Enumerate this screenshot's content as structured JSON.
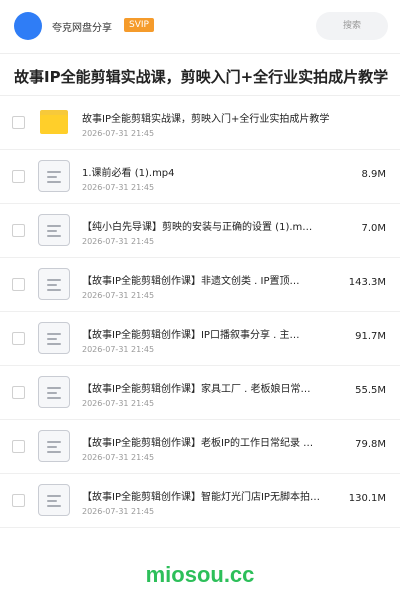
{
  "header": {
    "site_name": "夸克网盘分享",
    "badge": "SVIP",
    "search_label": "搜索"
  },
  "share_title": "故事IP全能剪辑实战课，剪映入门+全行业实拍成片教学",
  "files": [
    {
      "name": "故事IP全能剪辑实战课，剪映入门+全行业实拍成片教学",
      "date": "2026-07-31 21:45",
      "size": "",
      "icon": "folder-icon"
    },
    {
      "name": "1.课前必看 (1).mp4",
      "date": "2026-07-31 21:45",
      "size": "8.9M",
      "icon": "file-icon"
    },
    {
      "name": "【纯小白先导课】剪映的安装与正确的设置 (1).m…",
      "date": "2026-07-31 21:45",
      "size": "7.0M",
      "icon": "file-icon"
    },
    {
      "name": "【故事IP全能剪辑创作课】非遗文创类 . IP置顶…",
      "date": "2026-07-31 21:45",
      "size": "143.3M",
      "icon": "file-icon"
    },
    {
      "name": "【故事IP全能剪辑创作课】IP口播叙事分享 . 主…",
      "date": "2026-07-31 21:45",
      "size": "91.7M",
      "icon": "file-icon"
    },
    {
      "name": "【故事IP全能剪辑创作课】家具工厂 . 老板娘日常…",
      "date": "2026-07-31 21:45",
      "size": "55.5M",
      "icon": "file-icon"
    },
    {
      "name": "【故事IP全能剪辑创作课】老板IP的工作日常纪录 …",
      "date": "2026-07-31 21:45",
      "size": "79.8M",
      "icon": "file-icon"
    },
    {
      "name": "【故事IP全能剪辑创作课】智能灯光门店IP无脚本拍…",
      "date": "2026-07-31 21:45",
      "size": "130.1M",
      "icon": "file-icon"
    }
  ],
  "watermark": "miosou.cc"
}
